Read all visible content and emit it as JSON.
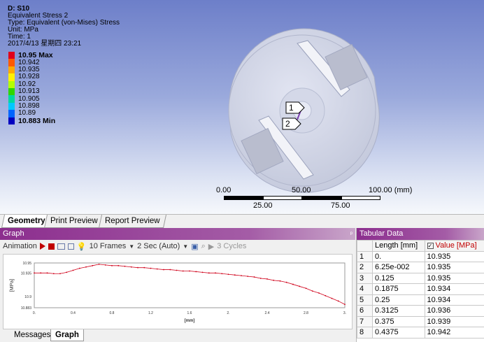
{
  "annotation": {
    "title": "D: S10",
    "lines": [
      "Equivalent Stress 2",
      "Type: Equivalent (von-Mises) Stress",
      "Unit: MPa",
      "Time: 1",
      "2017/4/13 星期四 23:21"
    ]
  },
  "legend": {
    "entries": [
      {
        "label": "10.95 Max",
        "color": "#e0001b",
        "bold": true
      },
      {
        "label": "10.942",
        "color": "#ff5a00"
      },
      {
        "label": "10.935",
        "color": "#ffaa00"
      },
      {
        "label": "10.928",
        "color": "#fff000"
      },
      {
        "label": "10.92",
        "color": "#b4ff00"
      },
      {
        "label": "10.913",
        "color": "#2fd600"
      },
      {
        "label": "10.905",
        "color": "#00d8a0"
      },
      {
        "label": "10.898",
        "color": "#00c8ff"
      },
      {
        "label": "10.89",
        "color": "#0064ff"
      },
      {
        "label": "10.883 Min",
        "color": "#0000c0",
        "bold": true
      }
    ]
  },
  "scale_bar": {
    "top_labels": [
      "0.00",
      "50.00",
      "100.00 (mm)"
    ],
    "bottom_labels": [
      "25.00",
      "75.00"
    ]
  },
  "probes": [
    "1",
    "2"
  ],
  "view_tabs": [
    "Geometry",
    "Print Preview",
    "Report Preview"
  ],
  "graph_panel": {
    "title": "Graph",
    "pin": "ᵖ",
    "toolbar": {
      "animation_label": "Animation",
      "frames": "10 Frames",
      "duration": "2 Sec (Auto)",
      "cycles": "3 Cycles"
    },
    "bottom_tabs": [
      "Messages",
      "Graph"
    ]
  },
  "chart_data": {
    "type": "line",
    "xlabel": "[mm]",
    "ylabel": "[MPa]",
    "x_ticks": [
      "0.",
      "0.4",
      "0.8",
      "1.2",
      "1.6",
      "2.",
      "2.4",
      "2.8",
      "3."
    ],
    "y_ticks": [
      "10.95",
      "10.935",
      "10.9",
      "10.883"
    ],
    "xlim": [
      0,
      3
    ],
    "ylim": [
      10.883,
      10.95
    ],
    "series": [
      {
        "color": "#d0021b",
        "x": [
          0,
          0.0625,
          0.125,
          0.1875,
          0.25,
          0.3125,
          0.375,
          0.4375,
          0.5,
          0.5625,
          0.625,
          0.6875,
          0.75,
          0.8125,
          0.875,
          0.9375,
          1.0,
          1.0625,
          1.125,
          1.1875,
          1.25,
          1.3125,
          1.375,
          1.4375,
          1.5,
          1.5625,
          1.625,
          1.6875,
          1.75,
          1.8125,
          1.875,
          1.9375,
          2.0,
          2.0625,
          2.125,
          2.1875,
          2.25,
          2.3125,
          2.375,
          2.4375,
          2.5,
          2.5625,
          2.625,
          2.6875,
          2.75,
          2.8125,
          2.875,
          2.9375,
          3.0
        ],
        "y": [
          10.935,
          10.935,
          10.935,
          10.934,
          10.934,
          10.936,
          10.939,
          10.942,
          10.944,
          10.946,
          10.948,
          10.947,
          10.946,
          10.946,
          10.945,
          10.944,
          10.943,
          10.943,
          10.942,
          10.941,
          10.94,
          10.94,
          10.939,
          10.938,
          10.938,
          10.937,
          10.936,
          10.935,
          10.935,
          10.934,
          10.933,
          10.932,
          10.931,
          10.93,
          10.929,
          10.927,
          10.926,
          10.924,
          10.923,
          10.921,
          10.918,
          10.915,
          10.912,
          10.908,
          10.905,
          10.901,
          10.897,
          10.893,
          10.888
        ]
      }
    ]
  },
  "table_panel": {
    "title": "Tabular Data",
    "col_length": "Length [mm]",
    "col_value": "Value [MPa]",
    "rows": [
      [
        "1",
        "0.",
        "10.935"
      ],
      [
        "2",
        "6.25e-002",
        "10.935"
      ],
      [
        "3",
        "0.125",
        "10.935"
      ],
      [
        "4",
        "0.1875",
        "10.934"
      ],
      [
        "5",
        "0.25",
        "10.934"
      ],
      [
        "6",
        "0.3125",
        "10.936"
      ],
      [
        "7",
        "0.375",
        "10.939"
      ],
      [
        "8",
        "0.4375",
        "10.942"
      ]
    ]
  }
}
